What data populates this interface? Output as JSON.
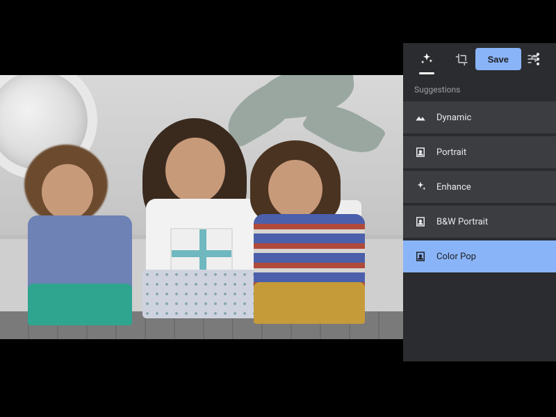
{
  "toolbar": {
    "save_label": "Save"
  },
  "panel": {
    "section_label": "Suggestions",
    "active_tab_index": 0,
    "suggestions": [
      {
        "label": "Dynamic",
        "icon": "landscape-icon",
        "selected": false
      },
      {
        "label": "Portrait",
        "icon": "portrait-icon",
        "selected": false
      },
      {
        "label": "Enhance",
        "icon": "sparkle-icon",
        "selected": false
      },
      {
        "label": "B&W Portrait",
        "icon": "portrait-icon",
        "selected": false
      },
      {
        "label": "Color Pop",
        "icon": "portrait-icon",
        "selected": true
      }
    ]
  }
}
